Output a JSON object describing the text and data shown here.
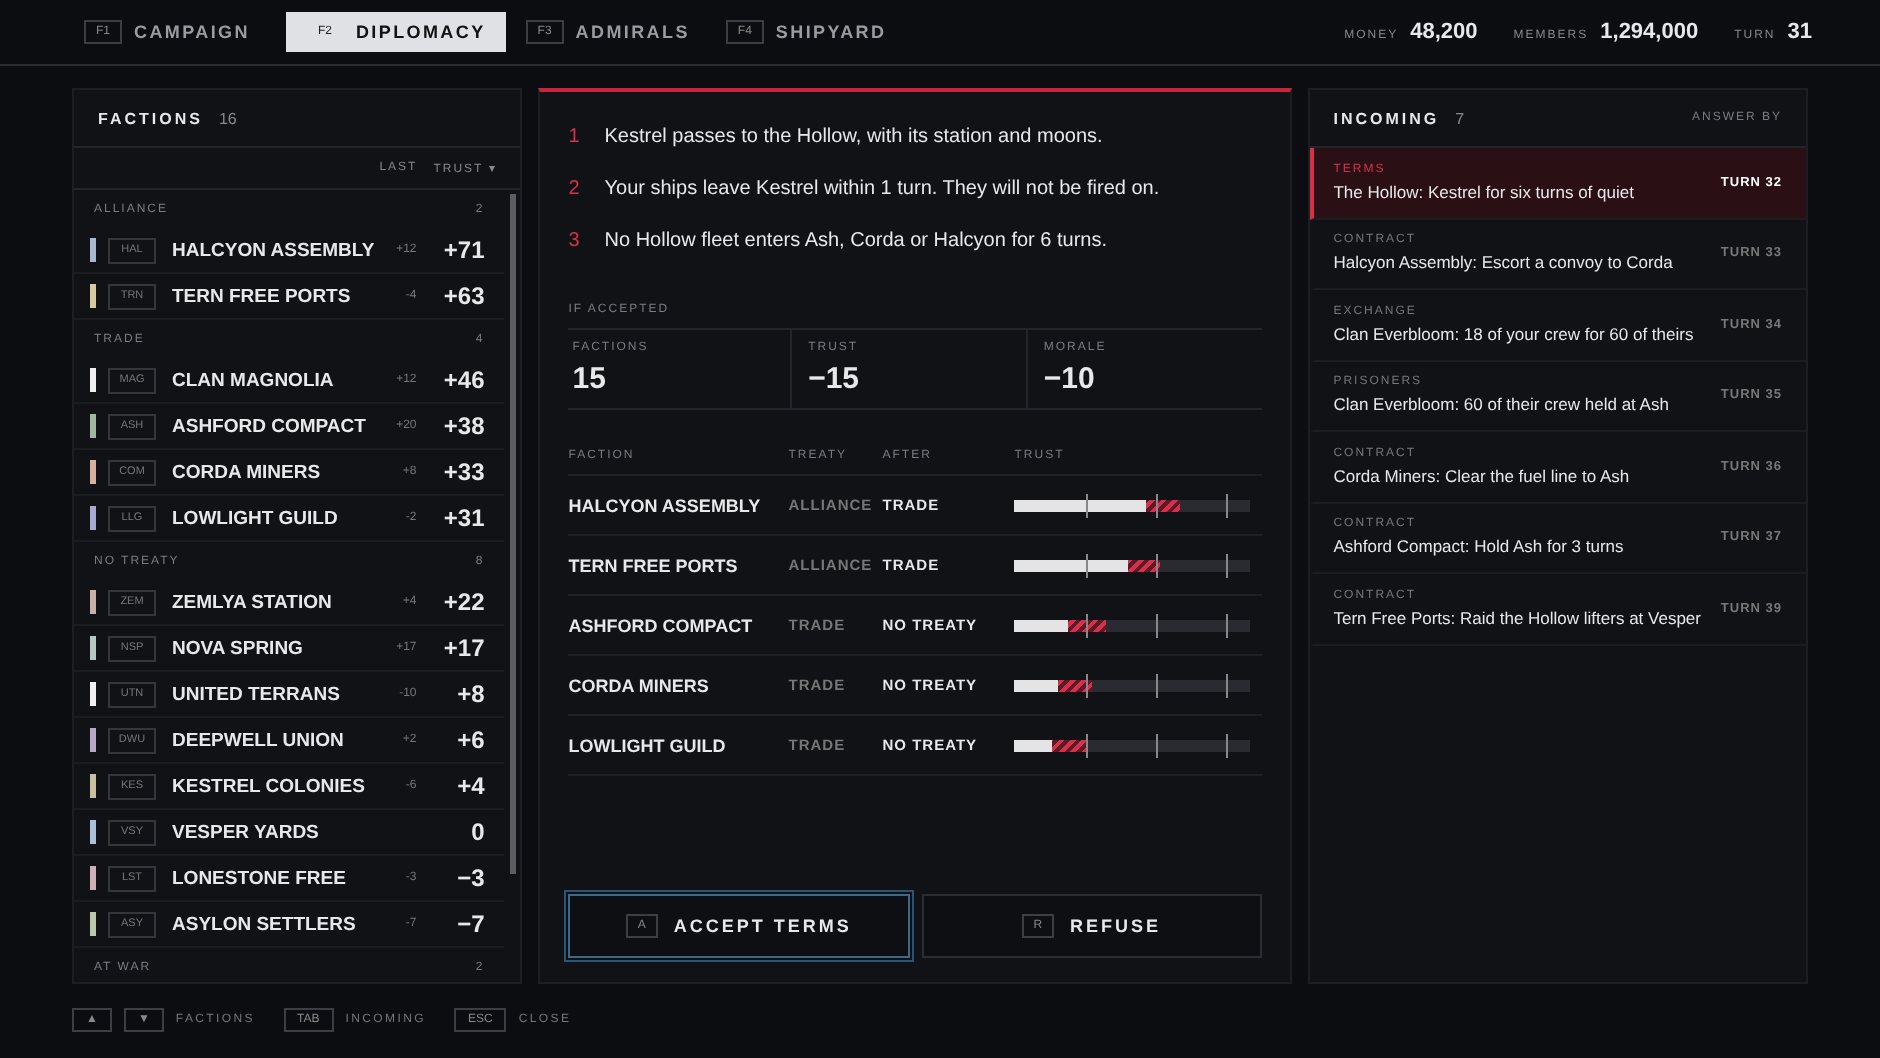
{
  "top_tabs": [
    {
      "key": "F1",
      "label": "CAMPAIGN",
      "selected": false
    },
    {
      "key": "F2",
      "label": "DIPLOMACY",
      "selected": true
    },
    {
      "key": "F3",
      "label": "ADMIRALS",
      "selected": false
    },
    {
      "key": "F4",
      "label": "SHIPYARD",
      "selected": false
    }
  ],
  "stats": [
    {
      "label": "MONEY",
      "value": "48,200"
    },
    {
      "label": "MEMBERS",
      "value": "1,294,000"
    },
    {
      "label": "TURN",
      "value": "31"
    }
  ],
  "factions": {
    "title": "FACTIONS",
    "count": "16",
    "columns": [
      "LAST",
      "TRUST"
    ],
    "sort_icon": "▾",
    "groups": [
      {
        "label": "ALLIANCE",
        "count": "2",
        "items": [
          {
            "code": "HAL",
            "name": "HALCYON ASSEMBLY",
            "last": "+12",
            "trust": "+71",
            "color": "#a8b8d4"
          },
          {
            "code": "TRN",
            "name": "TERN FREE PORTS",
            "last": "-4",
            "trust": "+63",
            "color": "#d8c8a0"
          }
        ]
      },
      {
        "label": "TRADE",
        "count": "4",
        "items": [
          {
            "code": "MAG",
            "name": "CLAN MAGNOLIA",
            "last": "+12",
            "trust": "+46",
            "color": "#f0f0f0"
          },
          {
            "code": "ASH",
            "name": "ASHFORD COMPACT",
            "last": "+20",
            "trust": "+38",
            "color": "#a0b8a0"
          },
          {
            "code": "COM",
            "name": "CORDA MINERS",
            "last": "+8",
            "trust": "+33",
            "color": "#d8b0a0"
          },
          {
            "code": "LLG",
            "name": "LOWLIGHT GUILD",
            "last": "-2",
            "trust": "+31",
            "color": "#a8a8d0"
          }
        ]
      },
      {
        "label": "NO TREATY",
        "count": "8",
        "items": [
          {
            "code": "ZEM",
            "name": "ZEMLYA STATION",
            "last": "+4",
            "trust": "+22",
            "color": "#c8b0a8"
          },
          {
            "code": "NSP",
            "name": "NOVA SPRING",
            "last": "+17",
            "trust": "+17",
            "color": "#b8c8c0"
          },
          {
            "code": "UTN",
            "name": "UNITED TERRANS",
            "last": "-10",
            "trust": "+8",
            "color": "#f0f0f0"
          },
          {
            "code": "DWU",
            "name": "DEEPWELL UNION",
            "last": "+2",
            "trust": "+6",
            "color": "#b8a8c8"
          },
          {
            "code": "KES",
            "name": "KESTREL COLONIES",
            "last": "-6",
            "trust": "+4",
            "color": "#c8c0a0"
          },
          {
            "code": "VSY",
            "name": "VESPER YARDS",
            "trust": "0",
            "color": "#a8c0d8"
          },
          {
            "code": "LST",
            "name": "LONESTONE FREE",
            "last": "-3",
            "trust": "−3",
            "color": "#d0b0b8"
          },
          {
            "code": "ASY",
            "name": "ASYLON SETTLERS",
            "last": "-7",
            "trust": "−7",
            "color": "#b8c8a8"
          }
        ]
      },
      {
        "label": "AT WAR",
        "count": "2"
      }
    ]
  },
  "terms": [
    {
      "number": "1",
      "text": "Kestrel passes to the Hollow, with its station and moons."
    },
    {
      "number": "2",
      "text": "Your ships leave Kestrel within 1 turn. They will not be fired on."
    },
    {
      "number": "3",
      "text": "No Hollow fleet enters Ash, Corda or Halcyon for 6 turns."
    }
  ],
  "if_accepted": {
    "label": "IF ACCEPTED",
    "stats": [
      {
        "label": "FACTIONS",
        "value": "15"
      },
      {
        "label": "TRUST",
        "value": "−15"
      },
      {
        "label": "MORALE",
        "value": "−10"
      }
    ]
  },
  "impact_table": {
    "columns": [
      "FACTION",
      "TREATY",
      "AFTER",
      "TRUST"
    ],
    "rows": [
      {
        "faction": "HALCYON ASSEMBLY",
        "treaty": "ALLIANCE",
        "after": "TRADE",
        "trust_after": {
          "level": 0.56
        },
        "trust_now": {
          "level": 0.7
        }
      },
      {
        "faction": "TERN FREE PORTS",
        "treaty": "ALLIANCE",
        "after": "TRADE",
        "trust_after": {
          "level": 0.48
        },
        "trust_now": {
          "level": 0.62
        }
      },
      {
        "faction": "ASHFORD COMPACT",
        "treaty": "TRADE",
        "after": "NO TREATY",
        "trust_after": {
          "level": 0.23
        },
        "trust_now": {
          "level": 0.39
        }
      },
      {
        "faction": "CORDA MINERS",
        "treaty": "TRADE",
        "after": "NO TREATY",
        "trust_after": {
          "level": 0.18
        },
        "trust_now": {
          "level": 0.33
        }
      },
      {
        "faction": "LOWLIGHT GUILD",
        "treaty": "TRADE",
        "after": "NO TREATY",
        "trust_after": {
          "level": 0.16
        },
        "trust_now": {
          "level": 0.31
        }
      }
    ]
  },
  "actions": [
    {
      "key": "A",
      "label": "ACCEPT TERMS",
      "selected": true
    },
    {
      "key": "R",
      "label": "REFUSE",
      "selected": false
    }
  ],
  "incoming": {
    "title": "INCOMING",
    "count": "7",
    "column": "ANSWER BY",
    "items": [
      {
        "type": "TERMS",
        "text": "The Hollow: Kestrel for six turns of quiet",
        "due": "TURN 32",
        "selected": true
      },
      {
        "type": "CONTRACT",
        "text": "Halcyon Assembly: Escort a convoy to Corda",
        "due": "TURN 33",
        "selected": false
      },
      {
        "type": "EXCHANGE",
        "text": "Clan Everbloom: 18 of your crew for 60 of theirs",
        "due": "TURN 34",
        "selected": false
      },
      {
        "type": "PRISONERS",
        "text": "Clan Everbloom: 60 of their crew held at Ash",
        "due": "TURN 35",
        "selected": false
      },
      {
        "type": "CONTRACT",
        "text": "Corda Miners: Clear the fuel line to Ash",
        "due": "TURN 36",
        "selected": false
      },
      {
        "type": "CONTRACT",
        "text": "Ashford Compact: Hold Ash for 3 turns",
        "due": "TURN 37",
        "selected": false
      },
      {
        "type": "CONTRACT",
        "text": "Tern Free Ports: Raid the Hollow lifters at Vesper",
        "due": "TURN 39",
        "selected": false
      }
    ]
  },
  "hints": [
    {
      "keys": [
        "▲",
        "▼"
      ],
      "label": "FACTIONS"
    },
    {
      "keys": [
        "TAB"
      ],
      "label": "INCOMING"
    },
    {
      "keys": [
        "ESC"
      ],
      "label": "CLOSE"
    }
  ]
}
